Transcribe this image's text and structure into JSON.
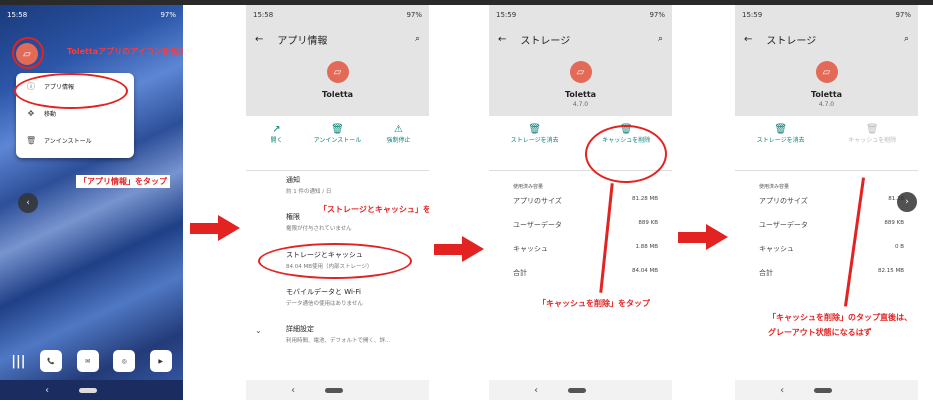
{
  "status": {
    "home_time": "15:58",
    "p2_time": "15:58",
    "p3_time": "15:59",
    "p4_time": "15:59",
    "battery": "97%"
  },
  "step1": {
    "instruction_longpress": "Tolettaアプリのアイコンを長押しする",
    "menu": [
      "アプリ情報",
      "移動",
      "アンインストール"
    ],
    "instruction_tap": "「アプリ情報」をタップ"
  },
  "step2": {
    "title": "アプリ情報",
    "app_name": "Toletta",
    "actions": [
      "開く",
      "アンインストール",
      "強制停止"
    ],
    "items": [
      {
        "title": "通知",
        "sub": "約 1 件の通知 / 日"
      },
      {
        "title": "権限",
        "sub": "権限が付与されていません"
      },
      {
        "title": "ストレージとキャッシュ",
        "sub": "84.04 MB使用（内部ストレージ）"
      },
      {
        "title": "モバイルデータと Wi-Fi",
        "sub": "データ通信の使用はありません"
      },
      {
        "title": "詳細設定",
        "sub": "利用時間、電池、デフォルトで開く、詳..."
      }
    ],
    "instruction": "「ストレージとキャッシュ」をタップ"
  },
  "step3": {
    "title": "ストレージ",
    "app_name": "Toletta",
    "version": "4.7.0",
    "clear_storage": "ストレージを消去",
    "clear_cache": "キャッシュを削除",
    "usage_caption": "使用済み容量",
    "rows": [
      {
        "label": "アプリのサイズ",
        "value": "81.28 MB"
      },
      {
        "label": "ユーザーデータ",
        "value": "889 KB"
      },
      {
        "label": "キャッシュ",
        "value": "1.88 MB"
      },
      {
        "label": "合計",
        "value": "84.04 MB"
      }
    ],
    "instruction": "「キャッシュを削除」をタップ"
  },
  "step4": {
    "title": "ストレージ",
    "app_name": "Toletta",
    "version": "4.7.0",
    "clear_storage": "ストレージを消去",
    "clear_cache": "キャッシュを削除",
    "usage_caption": "使用済み容量",
    "rows": [
      {
        "label": "アプリのサイズ",
        "value": "81.28"
      },
      {
        "label": "ユーザーデータ",
        "value": "889 KB"
      },
      {
        "label": "キャッシュ",
        "value": "0 B"
      },
      {
        "label": "合計",
        "value": "82.15 MB"
      }
    ],
    "instruction_line1": "「キャッシュを削除」のタップ直後は、",
    "instruction_line2": "グレーアウト状態になるはず"
  },
  "colors": {
    "accent": "#0b8077",
    "annotation": "#e32222",
    "app_icon": "#e46a58"
  }
}
